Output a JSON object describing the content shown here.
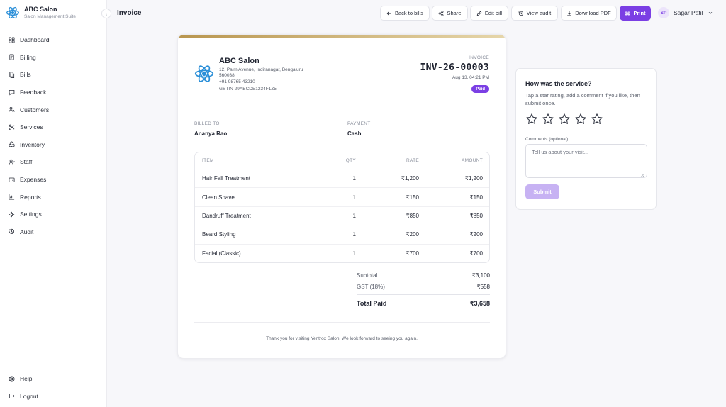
{
  "brand": {
    "name": "ABC Salon",
    "subtitle": "Salon Management Suite"
  },
  "sidebar": {
    "items": [
      {
        "label": "Dashboard",
        "icon": "grid-icon"
      },
      {
        "label": "Billing",
        "icon": "receipt-icon"
      },
      {
        "label": "Bills",
        "icon": "bills-icon"
      },
      {
        "label": "Feedback",
        "icon": "message-icon"
      },
      {
        "label": "Customers",
        "icon": "users-icon"
      },
      {
        "label": "Services",
        "icon": "scissors-icon"
      },
      {
        "label": "Inventory",
        "icon": "boxes-icon"
      },
      {
        "label": "Staff",
        "icon": "staff-icon"
      },
      {
        "label": "Expenses",
        "icon": "wallet-icon"
      },
      {
        "label": "Reports",
        "icon": "bar-chart-icon"
      },
      {
        "label": "Settings",
        "icon": "gear-icon"
      },
      {
        "label": "Audit",
        "icon": "history-icon"
      }
    ],
    "bottom": [
      {
        "label": "Help",
        "icon": "help-icon"
      },
      {
        "label": "Logout",
        "icon": "logout-icon"
      }
    ]
  },
  "header": {
    "title": "Invoice",
    "buttons": {
      "back": "Back to bills",
      "share": "Share",
      "edit": "Edit bill",
      "audit": "View audit",
      "pdf": "Download PDF",
      "print": "Print"
    },
    "user": {
      "initials": "SP",
      "name": "Sagar Patil"
    }
  },
  "invoice": {
    "salon_name": "ABC Salon",
    "address_line1": "12, Palm Avenue, Indiranagar, Bengaluru",
    "address_line2": "560038",
    "phone": "+91 98765 43210",
    "gstin": "GSTIN 29ABCDE1234F1Z5",
    "label": "INVOICE",
    "number": "INV-26-00003",
    "date": "Aug 13, 04:21 PM",
    "status": "Paid",
    "billed_to_label": "BILLED TO",
    "billed_to": "Ananya Rao",
    "payment_label": "PAYMENT",
    "payment": "Cash",
    "columns": {
      "item": "ITEM",
      "qty": "QTY",
      "rate": "RATE",
      "amount": "AMOUNT"
    },
    "items": [
      {
        "name": "Hair Fall Treatment",
        "qty": "1",
        "rate": "₹1,200",
        "amount": "₹1,200"
      },
      {
        "name": "Clean Shave",
        "qty": "1",
        "rate": "₹150",
        "amount": "₹150"
      },
      {
        "name": "Dandruff Treatment",
        "qty": "1",
        "rate": "₹850",
        "amount": "₹850"
      },
      {
        "name": "Beard Styling",
        "qty": "1",
        "rate": "₹200",
        "amount": "₹200"
      },
      {
        "name": "Facial (Classic)",
        "qty": "1",
        "rate": "₹700",
        "amount": "₹700"
      }
    ],
    "subtotal_label": "Subtotal",
    "subtotal": "₹3,100",
    "gst_label": "GST (18%)",
    "gst": "₹558",
    "total_label": "Total Paid",
    "total": "₹3,658",
    "thanks": "Thank you for visiting Yentrox Salon. We look forward to seeing you again."
  },
  "feedback": {
    "title": "How was the service?",
    "description": "Tap a star rating, add a comment if you like, then submit once.",
    "rating": 0,
    "max_rating": 5,
    "comments_label": "Comments (optional)",
    "comments_placeholder": "Tell us about your visit...",
    "submit": "Submit"
  },
  "colors": {
    "accent": "#7b3fe4",
    "accent_light": "#c7b2f3",
    "gold": "#c4a25c",
    "logo_blue": "#2b8fd8"
  }
}
